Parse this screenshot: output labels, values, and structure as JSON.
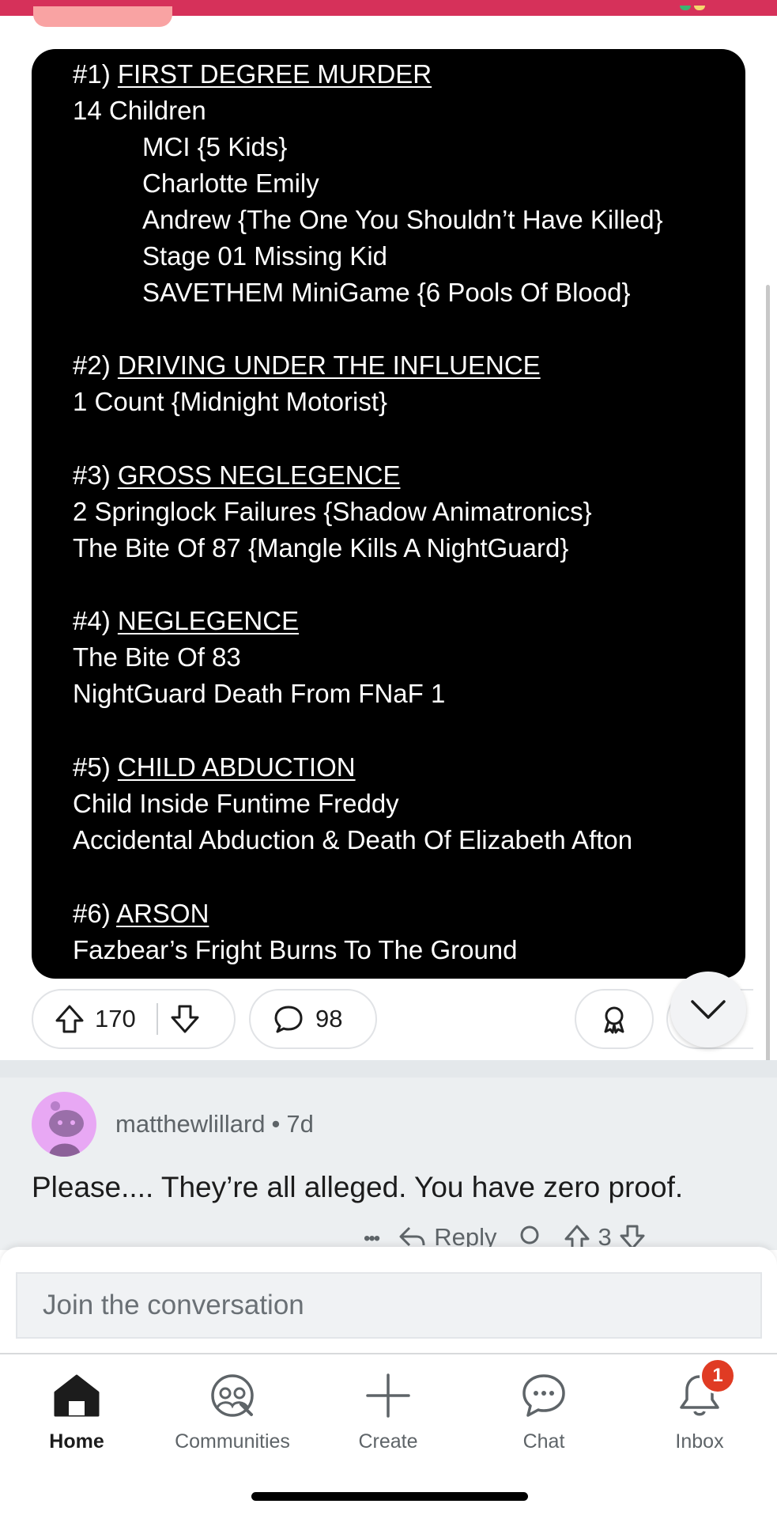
{
  "post": {
    "image_lines": {
      "h1_num": "#1)",
      "h1_title": "FIRST DEGREE MURDER",
      "l1": "14 Children",
      "l2": "MCI {5 Kids}",
      "l3": "Charlotte Emily",
      "l4": "Andrew {The One You Shouldn’t Have Killed}",
      "l5": "Stage 01 Missing Kid",
      "l6": "SAVETHEM MiniGame {6 Pools Of Blood}",
      "h2_num": "#2)",
      "h2_title": "DRIVING UNDER THE INFLUENCE",
      "l7": "1 Count {Midnight Motorist}",
      "h3_num": "#3)",
      "h3_title": "GROSS NEGLEGENCE",
      "l8": "2 Springlock Failures {Shadow Animatronics}",
      "l9": "The Bite Of 87 {Mangle Kills A NightGuard}",
      "h4_num": "#4)",
      "h4_title": "NEGLEGENCE",
      "l10": "The Bite Of 83",
      "l11": "NightGuard Death From FNaF 1",
      "h5_num": "#5)",
      "h5_title": "CHILD ABDUCTION",
      "l12": "Child Inside Funtime Freddy",
      "l13": "Accidental Abduction & Death Of Elizabeth Afton",
      "h6_num": "#6)",
      "h6_title": "ARSON",
      "l14": "Fazbear’s Fright Burns To The Ground"
    },
    "upvotes": "170",
    "comments": "98"
  },
  "comment": {
    "author": "matthewlillard",
    "separator": "•",
    "age": "7d",
    "text": "Please.... They’re all alleged. You have zero proof.",
    "more_label": "•••",
    "reply_label": "Reply",
    "votes": "3"
  },
  "composer": {
    "placeholder": "Join the conversation"
  },
  "nav": {
    "home": "Home",
    "communities": "Communities",
    "create": "Create",
    "chat": "Chat",
    "inbox": "Inbox",
    "inbox_badge": "1"
  },
  "colors": {
    "topbar": "#d6315a",
    "badge": "#e03b23",
    "avatar_bg": "#e8a8f4"
  }
}
